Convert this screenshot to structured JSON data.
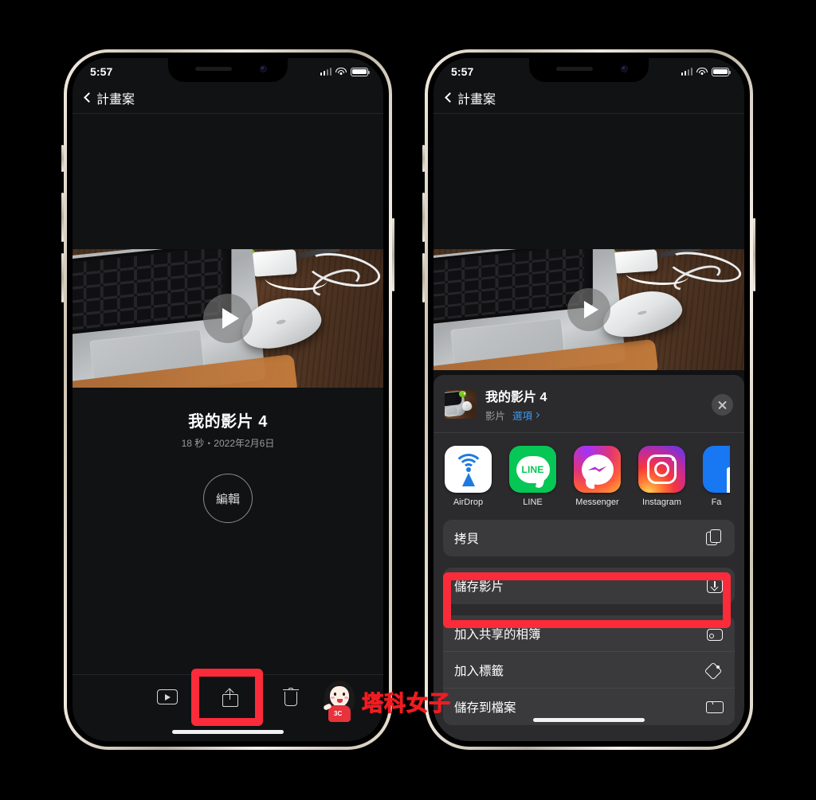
{
  "status_bar": {
    "time": "5:57",
    "cellular_icon": "signal-bars-icon",
    "wifi_icon": "wifi-icon",
    "battery_icon": "battery-icon"
  },
  "nav": {
    "back_label": "計畫案",
    "back_icon": "chevron-left-icon"
  },
  "left_phone": {
    "video": {
      "play_icon": "play-icon"
    },
    "meta": {
      "title": "我的影片 4",
      "subtitle": "18 秒・2022年2月6日"
    },
    "edit_button": "編輯",
    "toolbar": [
      {
        "name": "play-video-button",
        "icon": "play-rectangle-icon"
      },
      {
        "name": "share-button",
        "icon": "share-icon"
      },
      {
        "name": "delete-button",
        "icon": "trash-icon"
      }
    ]
  },
  "right_phone": {
    "share_sheet": {
      "title": "我的影片 4",
      "kind": "影片",
      "options_label": "選項",
      "options_chevron": "chevron-right-icon",
      "close_icon": "close-icon",
      "apps": [
        {
          "label": "AirDrop",
          "icon": "airdrop-icon"
        },
        {
          "label": "LINE",
          "icon": "line-icon"
        },
        {
          "label": "Messenger",
          "icon": "messenger-icon"
        },
        {
          "label": "Instagram",
          "icon": "instagram-icon"
        },
        {
          "label": "Fa",
          "icon": "facebook-icon"
        }
      ],
      "actions_group_1": [
        {
          "label": "拷貝",
          "icon": "copy-icon"
        }
      ],
      "actions_group_2": [
        {
          "label": "儲存影片",
          "icon": "save-video-icon",
          "highlighted": true
        }
      ],
      "actions_group_3": [
        {
          "label": "加入共享的相簿",
          "icon": "shared-album-icon"
        },
        {
          "label": "加入標籤",
          "icon": "tag-icon"
        },
        {
          "label": "儲存到檔案",
          "icon": "folder-icon"
        }
      ]
    }
  },
  "watermark": {
    "text": "塔科女子",
    "badge": "3C"
  },
  "colors": {
    "highlight": "#fb2b3a",
    "accent_blue": "#3c9cf0",
    "watermark_red": "#f01c22"
  }
}
